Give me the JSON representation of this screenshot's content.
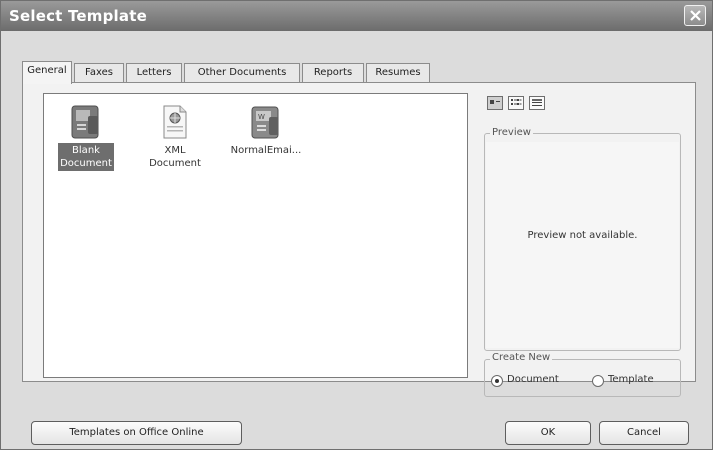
{
  "window": {
    "title": "Select Template"
  },
  "tabs": [
    {
      "label": "General",
      "active": true
    },
    {
      "label": "Faxes",
      "active": false
    },
    {
      "label": "Letters",
      "active": false
    },
    {
      "label": "Other Documents",
      "active": false
    },
    {
      "label": "Reports",
      "active": false
    },
    {
      "label": "Resumes",
      "active": false
    }
  ],
  "templates": [
    {
      "label_line1": "Blank",
      "label_line2": "Document",
      "icon": "blank-document-icon",
      "selected": true
    },
    {
      "label": "XML Document",
      "icon": "xml-document-icon",
      "selected": false
    },
    {
      "label": "NormalEmai...",
      "icon": "normal-email-icon",
      "selected": false
    }
  ],
  "view_buttons": [
    {
      "icon": "large-icons-view-icon",
      "active": true
    },
    {
      "icon": "list-view-icon",
      "active": false
    },
    {
      "icon": "details-view-icon",
      "active": false
    }
  ],
  "preview": {
    "label": "Preview",
    "message": "Preview not available."
  },
  "create_new": {
    "label": "Create New",
    "options": [
      {
        "label": "Document",
        "checked": true
      },
      {
        "label": "Template",
        "checked": false
      }
    ]
  },
  "buttons": {
    "online": "Templates on Office Online",
    "ok": "OK",
    "cancel": "Cancel"
  }
}
